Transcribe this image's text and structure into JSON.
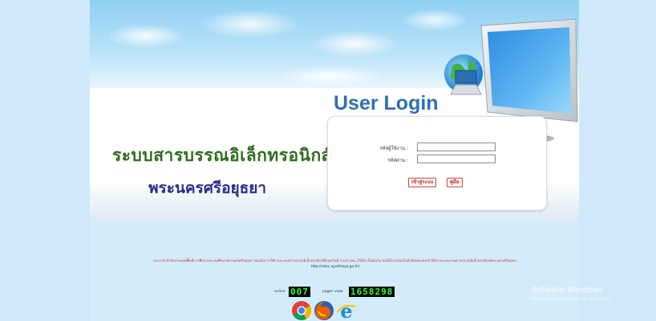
{
  "branding": {
    "system_name": "ระบบสารบรรณอิเล็กทรอนิกส์",
    "org_name": "พระนครศรีอยุธยา"
  },
  "login": {
    "heading": "User Login",
    "username_label": "รหัสผู้ใช้งาน :",
    "username_value": "",
    "password_label": "รหัสผ่าน :",
    "password_value": "",
    "submit_label": "เข้าสู่ระบบ",
    "manual_label": "คู่มือ"
  },
  "footer": {
    "notice": "ประกาศ สำนักงานเขตพื้นที่การศึกษาประถมศึกษาพระนครศรีอยุธยา ขอแจ้งการใช้งานระบบสารบรรณอิเล็กทรอนิกส์ตั้งแต่วันที่ 1 มกราคม 2564 เป็นต้นไป ขอให้โรงเรียนในสังกัดทุกแห่งเข้าใช้งานระบบงานสารบรรณอิเล็กทรอนิกส์พระนครศรีอยุธยา",
    "link": "http://edoc.ayutthaya.go.th/",
    "online_label": "online",
    "online_count": "007",
    "pageview_label": "pagec view",
    "pageview_count": "1658298"
  },
  "browsers": [
    "chrome-icon",
    "firefox-icon",
    "internet-explorer-icon"
  ],
  "watermark": {
    "title": "Activate Windows",
    "subtitle": "Go to Settings to activate Windows."
  },
  "colors": {
    "background": "#cfe9fb",
    "heading_blue": "#2f6fb5",
    "system_name_green": "#2e6b1d",
    "org_name_navy": "#2b2b8a",
    "button_red": "#c0282b",
    "counter_green": "#33ff33"
  }
}
